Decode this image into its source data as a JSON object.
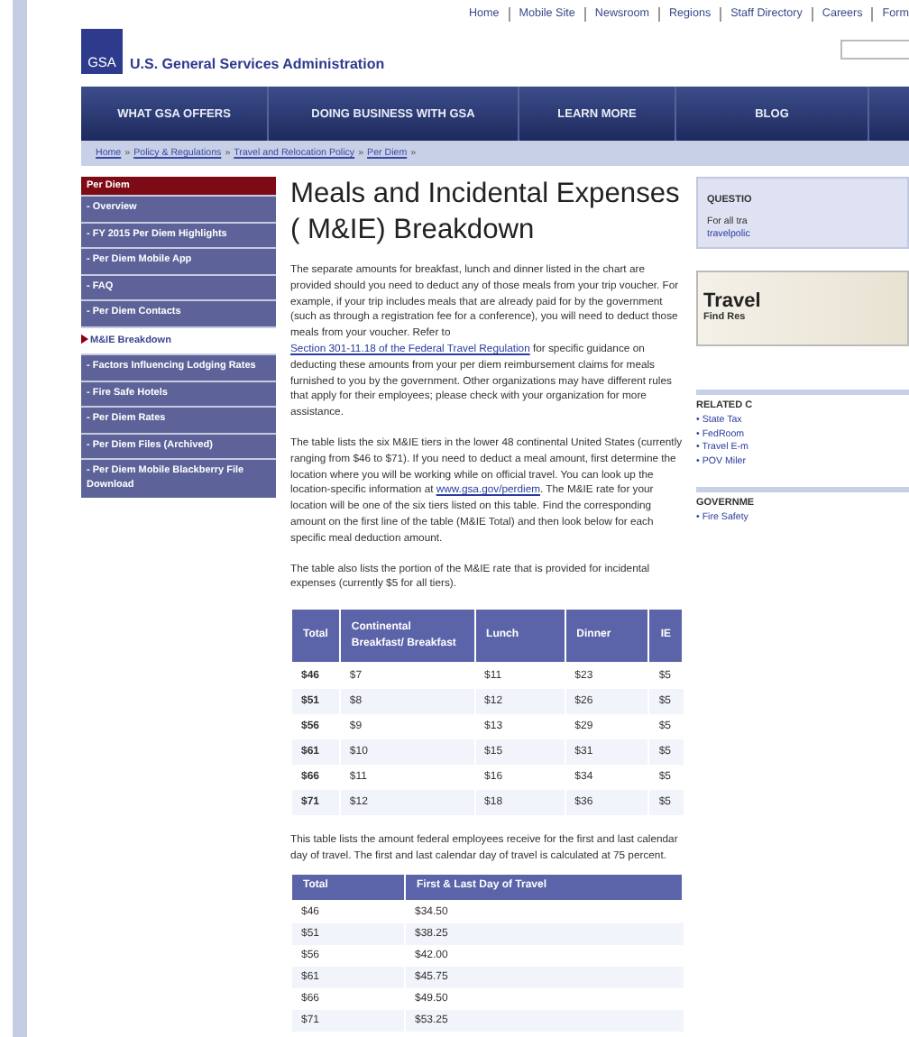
{
  "top_links": [
    "Home",
    "Mobile Site",
    "Newsroom",
    "Regions",
    "Staff Directory",
    "Careers",
    "Form"
  ],
  "logo": {
    "mark": "GSA",
    "name": "U.S. General Services Administration"
  },
  "nav": [
    "WHAT GSA OFFERS",
    "DOING BUSINESS WITH GSA",
    "LEARN MORE",
    "BLOG"
  ],
  "breadcrumb": {
    "separator": "»",
    "items": [
      "Home",
      "Policy & Regulations",
      "Travel and Relocation Policy",
      "Per Diem"
    ]
  },
  "sidebar": {
    "title": "Per Diem",
    "items": [
      {
        "label": "- Overview",
        "selected": false
      },
      {
        "label": "- FY 2015 Per Diem Highlights",
        "selected": false
      },
      {
        "label": "- Per Diem Mobile App",
        "selected": false
      },
      {
        "label": "- FAQ",
        "selected": false
      },
      {
        "label": "- Per Diem Contacts",
        "selected": false
      },
      {
        "label": "M&IE Breakdown",
        "selected": true
      },
      {
        "label": "- Factors Influencing Lodging Rates",
        "selected": false
      },
      {
        "label": "- Fire Safe Hotels",
        "selected": false
      },
      {
        "label": "- Per Diem Rates",
        "selected": false
      },
      {
        "label": "- Per Diem Files (Archived)",
        "selected": false
      },
      {
        "label": "- Per Diem Mobile Blackberry File Download",
        "selected": false
      }
    ]
  },
  "title": "Meals and Incidental Expenses ( M&IE) Breakdown",
  "paragraphs": [
    [
      {
        "kind": "text",
        "text": "The separate amounts for breakfast, lunch and dinner listed in the chart are provided should you need to deduct any of those meals from your trip voucher. For example, if your trip includes meals that are already paid for by the government (such as through a registration fee for a conference), you will need to deduct those meals from your voucher.  Refer to "
      },
      {
        "kind": "link",
        "text": "Section 301-11.18 of the Federal Travel Regulation"
      },
      {
        "kind": "text",
        "text": " for specific guidance on deducting these amounts from your per diem reimbursement claims for meals furnished to you by the government. Other organizations may have different rules that apply for their employees; please check with your organization for more assistance."
      }
    ],
    [
      {
        "kind": "text",
        "text": "The table lists the six M&IE tiers in the lower 48 continental United States (currently ranging from $46 to $71). If you need to deduct a meal amount, first determine the location where you will be working while on official travel.  You can look up the location-specific information at "
      },
      {
        "kind": "link",
        "text": "www.gsa.gov/perdiem"
      },
      {
        "kind": "text",
        "text": ".  The M&IE rate for your location will be one of the six tiers listed on this table.  Find the corresponding amount on the first line of the table (M&IE Total) and then look below for each specific meal deduction amount."
      }
    ],
    [
      {
        "kind": "text",
        "text": "The table also lists the portion of the M&IE rate that is provided for incidental expenses (currently $5 for all tiers)."
      }
    ]
  ],
  "meals_table": {
    "columns": [
      "Total",
      "Continental Breakfast/ Breakfast",
      "Lunch",
      "Dinner",
      "IE"
    ],
    "rows": [
      [
        "$46",
        "$7",
        "$11",
        "$23",
        "$5"
      ],
      [
        "$51",
        "$8",
        "$12",
        "$26",
        "$5"
      ],
      [
        "$56",
        "$9",
        "$13",
        "$29",
        "$5"
      ],
      [
        "$61",
        "$10",
        "$15",
        "$31",
        "$5"
      ],
      [
        "$66",
        "$11",
        "$16",
        "$34",
        "$5"
      ],
      [
        "$71",
        "$12",
        "$18",
        "$36",
        "$5"
      ]
    ]
  },
  "travel_note": "This table lists the amount federal employees receive for the first and last calendar day of travel. The first and last calendar day of travel is calculated at 75 percent.",
  "travel_table": {
    "columns": [
      "Total",
      "First & Last Day of Travel"
    ],
    "rows": [
      [
        "$46",
        "$34.50"
      ],
      [
        "$51",
        "$38.25"
      ],
      [
        "$56",
        "$42.00"
      ],
      [
        "$61",
        "$45.75"
      ],
      [
        "$66",
        "$49.50"
      ],
      [
        "$71",
        "$53.25"
      ]
    ]
  },
  "right": {
    "question": {
      "title": "QUESTIO",
      "lines": [
        "For all tra",
        "travelpolic"
      ]
    },
    "banner": {
      "title": "Travel",
      "subtitle": "Find Res"
    },
    "related": {
      "title": "RELATED C",
      "items": [
        "• State Tax",
        "• FedRoom",
        "• Travel E-m",
        "• POV Miler"
      ]
    },
    "government": {
      "title": "GOVERNME",
      "items": [
        "• Fire Safety"
      ]
    }
  }
}
